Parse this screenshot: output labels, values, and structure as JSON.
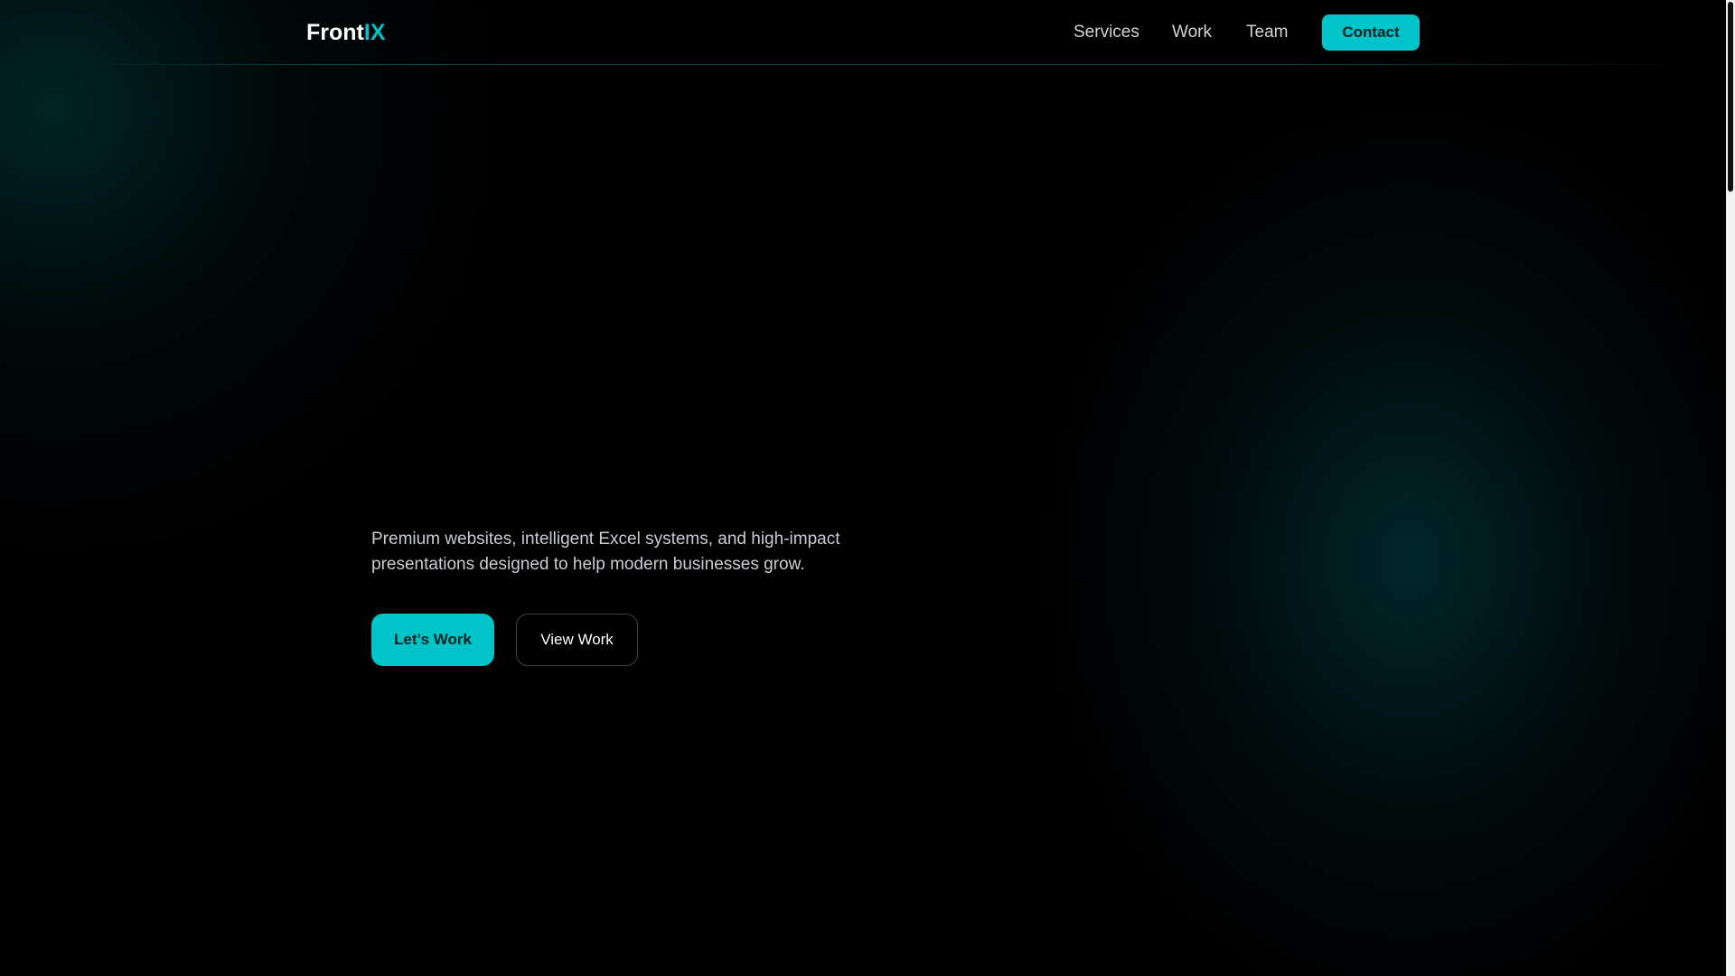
{
  "header": {
    "logo_main": "Front",
    "logo_accent": "IX",
    "nav": [
      "Services",
      "Work",
      "Team"
    ],
    "contact_label": "Contact"
  },
  "hero": {
    "description": "Premium websites, intelligent Excel systems, and high-impact presentations designed to help modern businesses grow.",
    "primary_cta": "Let’s Work",
    "secondary_cta": "View Work"
  },
  "colors": {
    "accent": "#00c4c8",
    "background": "#000000"
  }
}
